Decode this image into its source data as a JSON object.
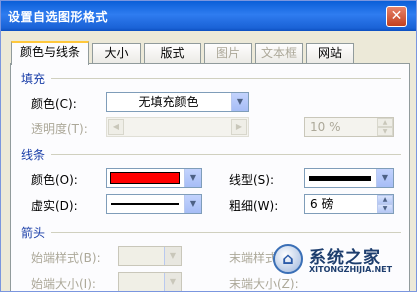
{
  "window": {
    "title": "设置自选图形格式",
    "close_glyph": "✕"
  },
  "tabs": [
    {
      "label": "颜色与线条",
      "state": "active"
    },
    {
      "label": "大小",
      "state": "normal"
    },
    {
      "label": "版式",
      "state": "normal"
    },
    {
      "label": "图片",
      "state": "disabled"
    },
    {
      "label": "文本框",
      "state": "disabled"
    },
    {
      "label": "网站",
      "state": "normal"
    }
  ],
  "fill": {
    "section_title": "填充",
    "color_label": "颜色(C):",
    "color_value": "无填充颜色",
    "transparency_label": "透明度(T):",
    "transparency_value": "10 %"
  },
  "line": {
    "section_title": "线条",
    "color_label": "颜色(O):",
    "color_swatch": "#ff0000",
    "style_label": "线型(S):",
    "dash_label": "虚实(D):",
    "weight_label": "粗细(W):",
    "weight_value": "6 磅"
  },
  "arrows": {
    "section_title": "箭头",
    "begin_style_label": "始端样式(B):",
    "end_style_label": "末端样式(E):",
    "begin_size_label": "始端大小(I):",
    "end_size_label": "末端大小(Z):"
  },
  "watermark": {
    "text": "系统之家",
    "sub": "XITONGZHIJIA.NET"
  },
  "icons": {
    "dropdown": "▼",
    "spin_up": "▲",
    "spin_down": "▼",
    "scroll_left": "◀",
    "scroll_right": "▶"
  }
}
